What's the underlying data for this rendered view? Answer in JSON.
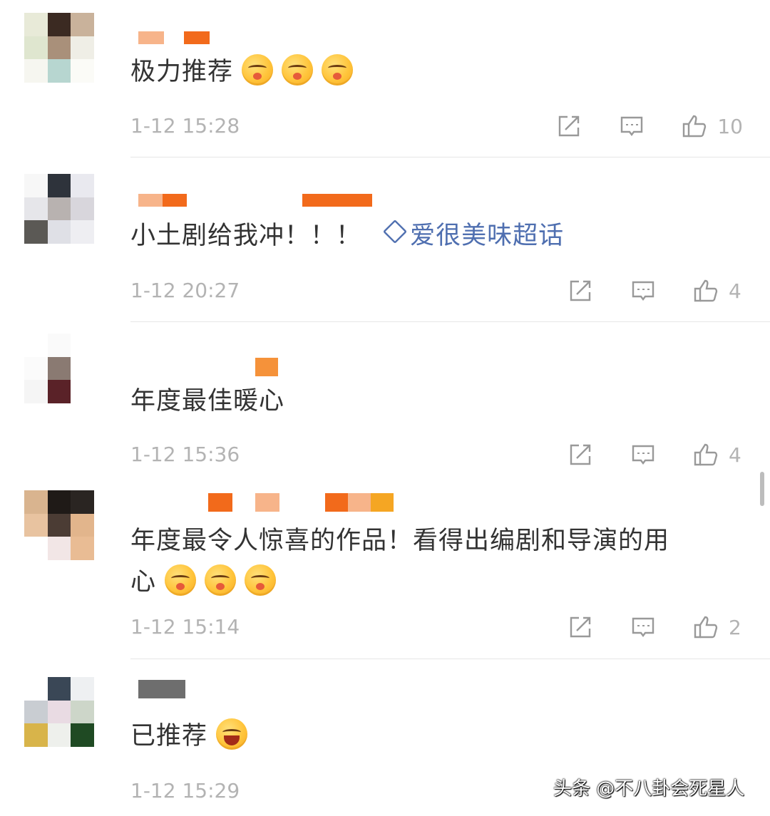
{
  "colors": {
    "text": "#333333",
    "meta": "#b3b3b3",
    "topic": "#4f6fb0",
    "name_blur_primary": "#f26a1b",
    "name_blur_light": "#f7b48a",
    "divider": "#e6e6e6"
  },
  "comments": [
    {
      "text": "极力推荐",
      "emojis": [
        "blush-face-emoji",
        "blush-face-emoji",
        "blush-face-emoji"
      ],
      "time": "1-12 15:28",
      "likes": "10"
    },
    {
      "text": "小土剧给我冲！！！",
      "topic": "爱很美味超话",
      "time": "1-12 20:27",
      "likes": "4"
    },
    {
      "text": "年度最佳暖心",
      "time": "1-12 15:36",
      "likes": "4"
    },
    {
      "text_line1": "年度最令人惊喜的作品！看得出编剧和导演的用",
      "text_line2": "心",
      "emojis": [
        "blush-face-emoji",
        "blush-face-emoji",
        "blush-face-emoji"
      ],
      "time": "1-12 15:14",
      "likes": "2"
    },
    {
      "text": "已推荐",
      "emojis": [
        "laughing-face-emoji"
      ],
      "time": "1-12 15:29"
    }
  ],
  "icons": {
    "repost": "repost-icon",
    "reply": "comment-icon",
    "like": "thumbs-up-icon"
  },
  "watermark": "头条 @不八卦会死星人"
}
